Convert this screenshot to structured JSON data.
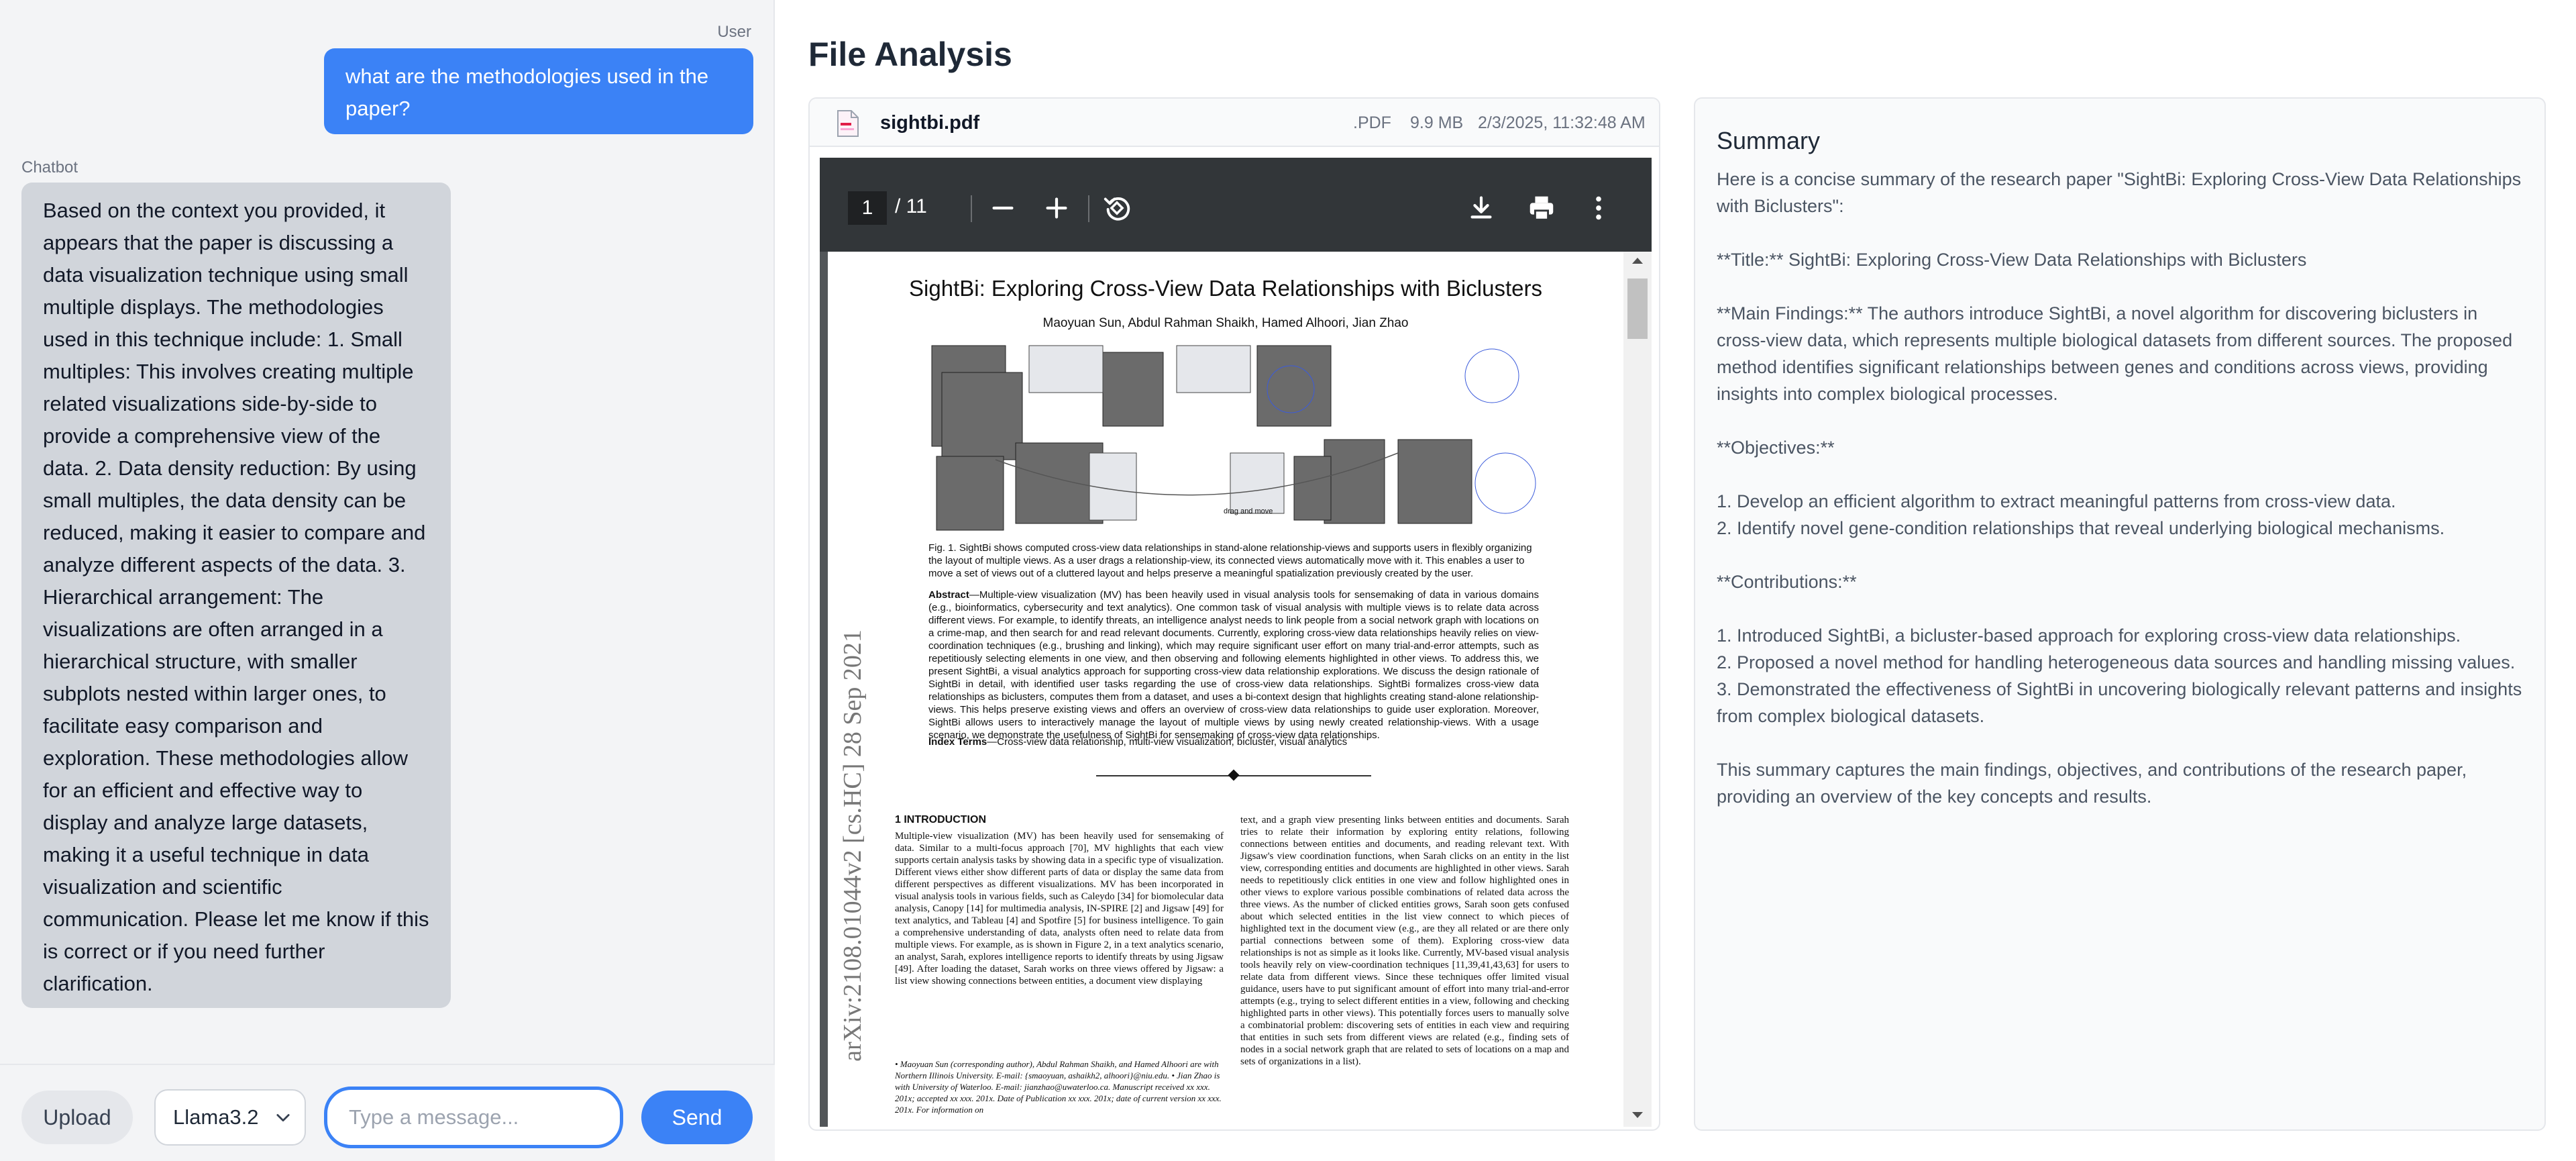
{
  "chat": {
    "user_label": "User",
    "bot_label": "Chatbot",
    "user_message": "what are the methodologies used in the paper?",
    "bot_message": "Based on the context you provided, it appears that the paper is discussing a data visualization technique using small multiple displays. The methodologies used in this technique include: 1. Small multiples: This involves creating multiple related visualizations side-by-side to provide a comprehensive view of the data. 2. Data density reduction: By using small multiples, the data density can be reduced, making it easier to compare and analyze different aspects of the data. 3. Hierarchical arrangement: The visualizations are often arranged in a hierarchical structure, with smaller subplots nested within larger ones, to facilitate easy comparison and exploration. These methodologies allow for an efficient and effective way to display and analyze large datasets, making it a useful technique in data visualization and scientific communication. Please let me know if this is correct or if you need further clarification."
  },
  "input_bar": {
    "upload_label": "Upload",
    "model_selected": "Llama3.2",
    "placeholder": "Type a message...",
    "send_label": "Send"
  },
  "file_analysis": {
    "title": "File Analysis",
    "file_name": "sightbi.pdf",
    "file_ext": ".PDF",
    "file_size": "9.9 MB",
    "file_date": "2/3/2025, 11:32:48 AM"
  },
  "pdf": {
    "page_current": "1",
    "page_total": "/ 11",
    "paper_title": "SightBi: Exploring Cross-View Data Relationships with Biclusters",
    "paper_authors": "Maoyuan Sun, Abdul Rahman Shaikh, Hamed Alhoori, Jian Zhao",
    "arxiv_stamp": "arXiv:2108.01044v2  [cs.HC]  28 Sep 2021",
    "teaser_label": "drag and move",
    "fig_caption": "Fig. 1. SightBi shows computed cross-view data relationships in stand-alone relationship-views and supports users in flexibly organizing the layout of multiple views. As a user drags a relationship-view, its connected views automatically move with it. This enables a user to move a set of views out of a cluttered layout and helps preserve a meaningful spatialization previously created by the user.",
    "abstract_label": "Abstract",
    "abstract": "—Multiple-view visualization (MV) has been heavily used in visual analysis tools for sensemaking of data in various domains (e.g., bioinformatics, cybersecurity and text analytics). One common task of visual analysis with multiple views is to relate data across different views. For example, to identify threats, an intelligence analyst needs to link people from a social network graph with locations on a crime-map, and then search for and read relevant documents. Currently, exploring cross-view data relationships heavily relies on view-coordination techniques (e.g., brushing and linking), which may require significant user effort on many trial-and-error attempts, such as repetitiously selecting elements in one view, and then observing and following elements highlighted in other views. To address this, we present SightBi, a visual analytics approach for supporting cross-view data relationship explorations. We discuss the design rationale of SightBi in detail, with identified user tasks regarding the use of cross-view data relationships. SightBi formalizes cross-view data relationships as biclusters, computes them from a dataset, and uses a bi-context design that highlights creating stand-alone relationship-views. This helps preserve existing views and offers an overview of cross-view data relationships to guide user exploration. Moreover, SightBi allows users to interactively manage the layout of multiple views by using newly created relationship-views. With a usage scenario, we demonstrate the usefulness of SightBi for sensemaking of cross-view data relationships.",
    "index_terms_label": "Index Terms",
    "index_terms": "—Cross-view data relationship, multi-view visualization, bicluster, visual analytics",
    "intro_heading": "1   INTRODUCTION",
    "col_left": "Multiple-view visualization (MV) has been heavily used for sensemaking of data. Similar to a multi-focus approach [70], MV highlights that each view supports certain analysis tasks by showing data in a specific type of visualization. Different views either show different parts of data or display the same data from different perspectives as different visualizations. MV has been incorporated in visual analysis tools in various fields, such as Caleydo [34] for biomolecular data analysis, Canopy [14] for multimedia analysis, IN-SPIRE [2] and Jigsaw [49] for text analytics, and Tableau [4] and Spotfire [5] for business intelligence. To gain a comprehensive understanding of data, analysts often need to relate data from multiple views. For example, as is shown in Figure 2, in a text analytics scenario, an analyst, Sarah, explores intelligence reports to identify threats by using Jigsaw [49]. After loading the dataset, Sarah works on three views offered by Jigsaw: a list view showing connections between entities, a document view displaying",
    "col_right": "text, and a graph view presenting links between entities and documents. Sarah tries to relate their information by exploring entity relations, following connections between entities and documents, and reading relevant text. With Jigsaw's view coordination functions, when Sarah clicks on an entity in the list view, corresponding entities and documents are highlighted in other views. Sarah needs to repetitiously click entities in one view and follow highlighted ones in other views to explore various possible combinations of related data across the three views. As the number of clicked entities grows, Sarah soon gets confused about which selected entities in the list view connect to which pieces of highlighted text in the document view (e.g., are they all related or are there only partial connections between some of them). Exploring cross-view data relationships is not as simple as it looks like. Currently, MV-based visual analysis tools heavily rely on view-coordination techniques [11,39,41,43,63] for users to relate data from different views. Since these techniques offer limited visual guidance, users have to put significant amount of effort into many trial-and-error attempts (e.g., trying to select different entities in a view, following and checking highlighted parts in other views). This potentially forces users to manually solve a combinatorial problem: discovering sets of entities in each view and requiring that entities in such sets from different views are related (e.g., finding sets of nodes in a social network graph that are related to sets of locations on a map and sets of organizations in a list).",
    "footnote": "• Maoyuan Sun (corresponding author), Abdul Rahman Shaikh, and Hamed Alhoori are with Northern Illinois University. E-mail: {smaoyuan, ashaikh2, alhoori}@niu.edu. • Jian Zhao is with University of Waterloo. E-mail: jianzhao@uwaterloo.ca. Manuscript received xx xxx. 201x; accepted xx xxx. 201x. Date of Publication xx xxx. 201x; date of current version xx xxx. 201x. For information on"
  },
  "summary": {
    "title": "Summary",
    "lines": [
      "Here is a concise summary of the research paper \"SightBi: Exploring Cross-View Data Relationships with Biclusters\":",
      "",
      "**Title:** SightBi: Exploring Cross-View Data Relationships with Biclusters",
      "",
      "**Main Findings:** The authors introduce SightBi, a novel algorithm for discovering biclusters in cross-view data, which represents multiple biological datasets from different sources. The proposed method identifies significant relationships between genes and conditions across views, providing insights into complex biological processes.",
      "",
      "**Objectives:**",
      "",
      "1. Develop an efficient algorithm to extract meaningful patterns from cross-view data.",
      "2. Identify novel gene-condition relationships that reveal underlying biological mechanisms.",
      "",
      "**Contributions:**",
      "",
      "1. Introduced SightBi, a bicluster-based approach for exploring cross-view data relationships.",
      "2. Proposed a novel method for handling heterogeneous data sources and handling missing values.",
      "3. Demonstrated the effectiveness of SightBi in uncovering biologically relevant patterns and insights from complex biological datasets.",
      "",
      "This summary captures the main findings, objectives, and contributions of the research paper, providing an overview of the key concepts and results."
    ]
  },
  "icons": {
    "file": "pdf-file-icon",
    "zoom_out": "minus-icon",
    "zoom_in": "plus-icon",
    "rotate": "rotate-icon",
    "download": "download-icon",
    "print": "print-icon",
    "more": "more-vertical-icon",
    "chevron": "chevron-down-icon"
  },
  "colors": {
    "accent": "#3b82f6",
    "user_bubble": "#3b82f6",
    "bot_bubble": "#d1d5db",
    "pdf_toolbar": "#323639"
  }
}
